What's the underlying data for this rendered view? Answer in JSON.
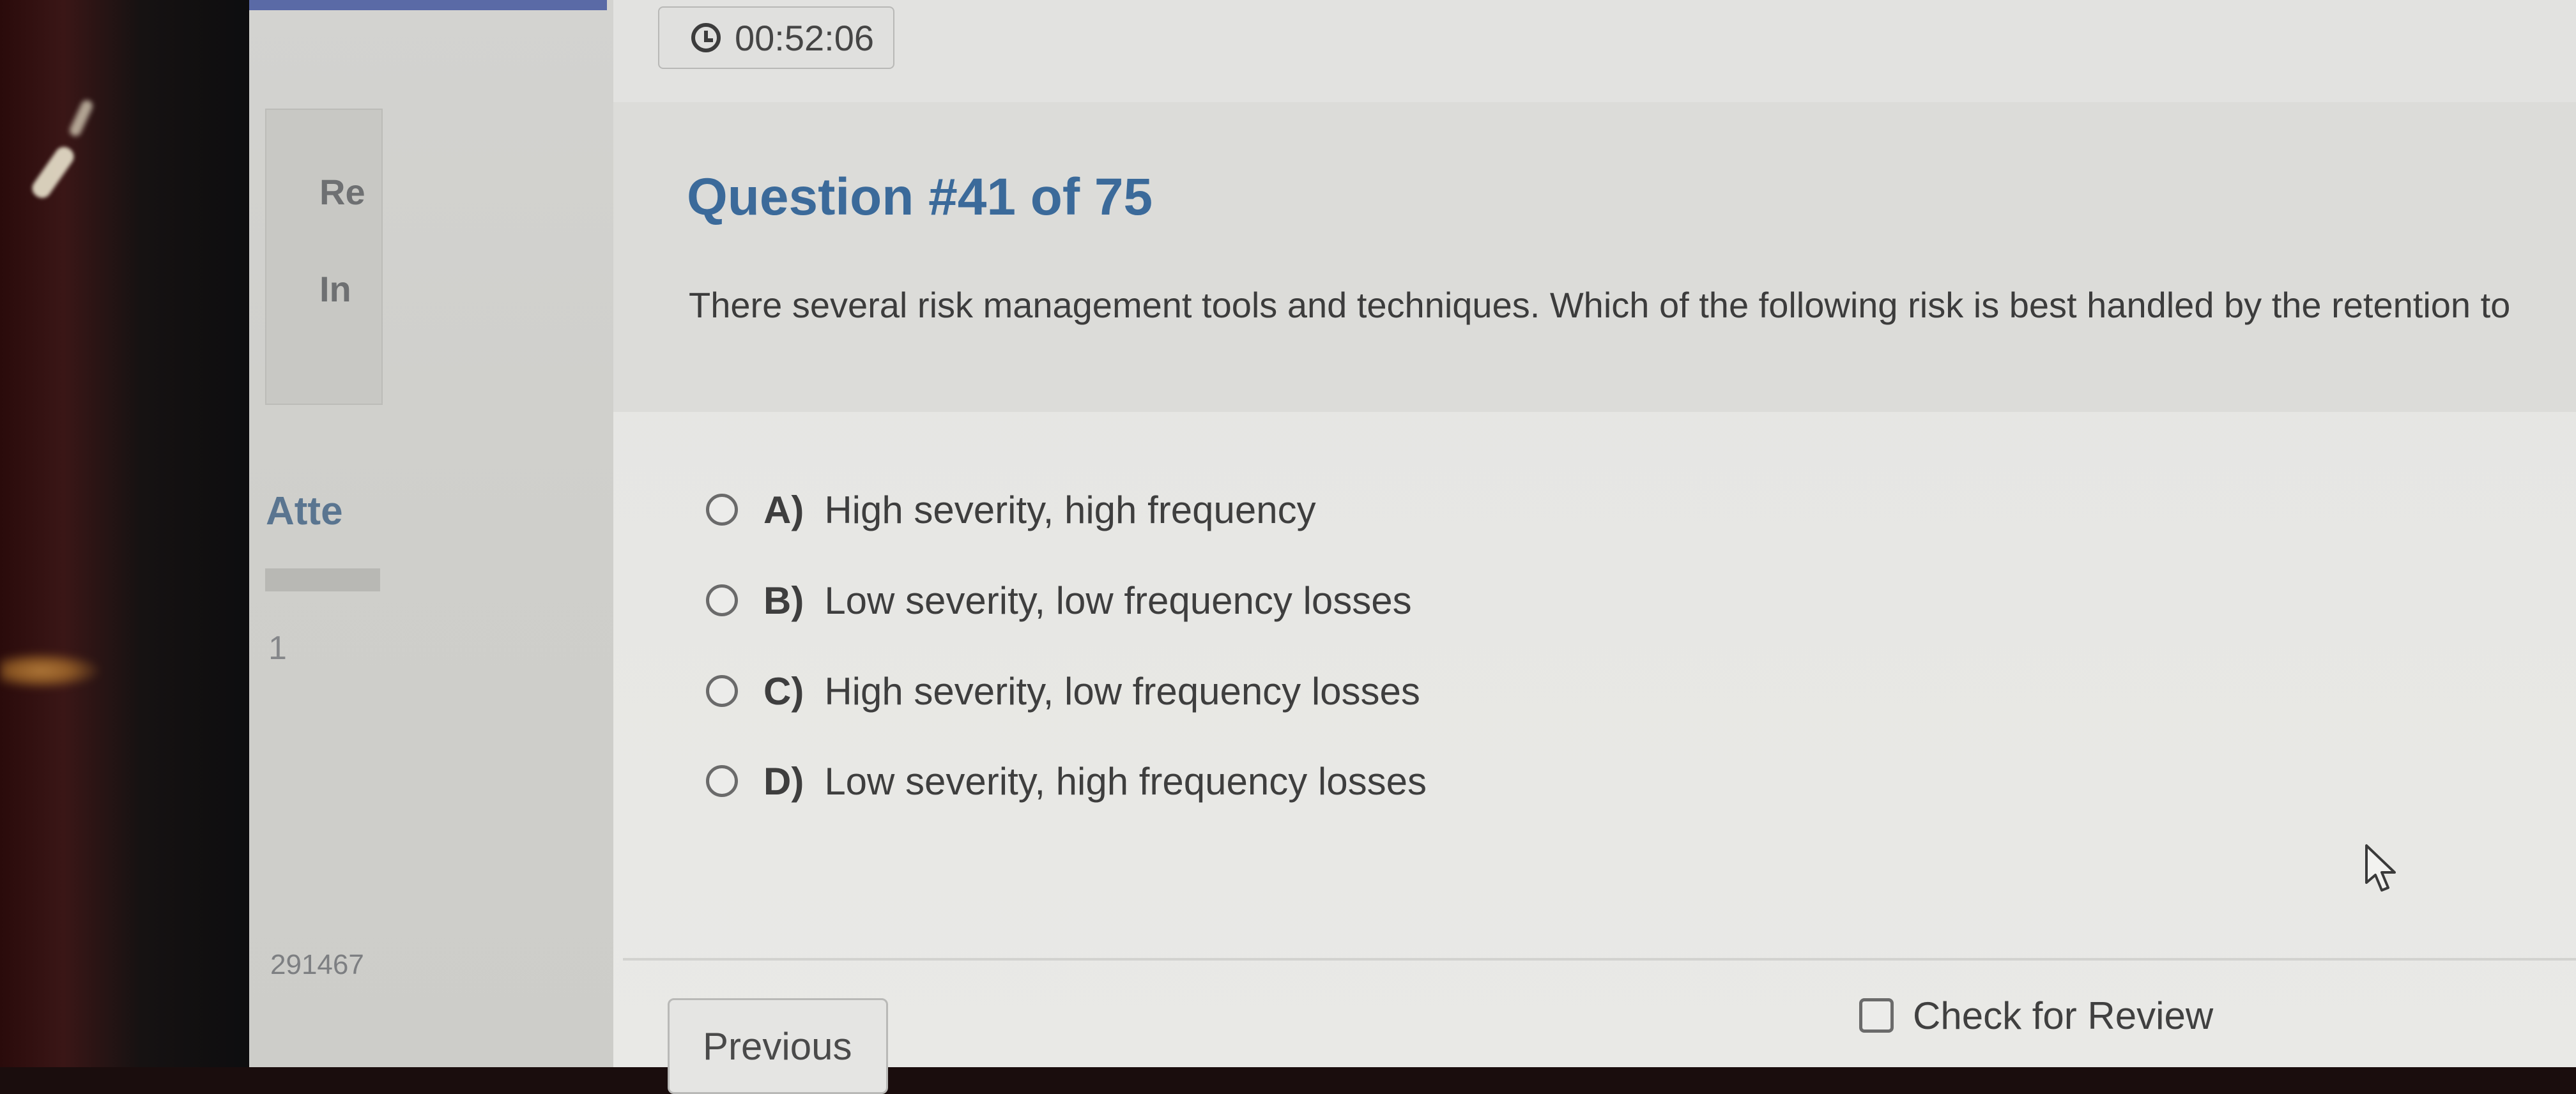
{
  "timer": {
    "icon": "clock-icon",
    "value": "00:52:06"
  },
  "background_panel": {
    "heading_fragment": "Re",
    "text_fragment": "In",
    "section_fragment": "Atte",
    "row_number": "1",
    "id_fragment": "291467"
  },
  "question": {
    "title": "Question #41 of 75",
    "text": "There several risk management tools and techniques. Which of the following risk is best handled by the retention to"
  },
  "options": [
    {
      "letter": "A)",
      "text": "High severity, high frequency",
      "selected": false
    },
    {
      "letter": "B)",
      "text": "Low severity, low frequency losses",
      "selected": false
    },
    {
      "letter": "C)",
      "text": "High severity, low frequency losses",
      "selected": false
    },
    {
      "letter": "D)",
      "text": "Low severity, high frequency losses",
      "selected": false
    }
  ],
  "footer": {
    "previous_label": "Previous",
    "review_label": "Check for Review",
    "review_checked": false
  },
  "colors": {
    "title": "#3b6a9a",
    "text": "#3e3e3e",
    "panel": "#e6e6e3",
    "accent_bar": "#5a6aa6"
  }
}
